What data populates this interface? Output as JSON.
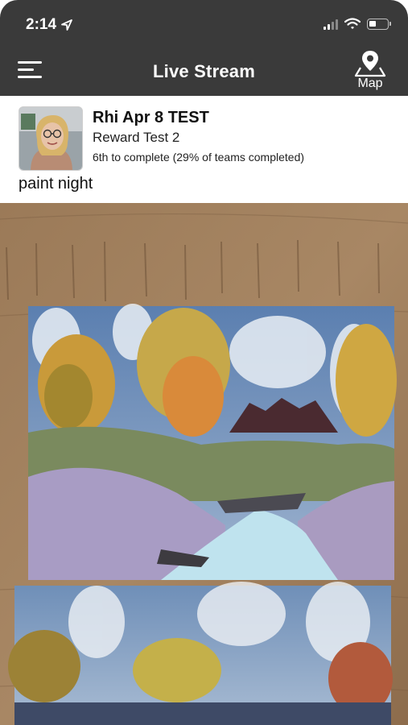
{
  "status_bar": {
    "time": "2:14",
    "location_icon": "location-arrow-icon",
    "signal_icon": "cellular-signal-icon",
    "wifi_icon": "wifi-icon",
    "battery_icon": "battery-icon",
    "battery_level": 0.35
  },
  "nav": {
    "menu_icon": "hamburger-menu-icon",
    "title": "Live Stream",
    "map_icon": "map-pin-icon",
    "map_label": "Map"
  },
  "post": {
    "name": "Rhi Apr 8 TEST",
    "reward": "Reward Test 2",
    "status": "6th to complete (29% of teams completed)",
    "caption": "paint night"
  },
  "photo": {
    "subject": "photo-of-two-landscape-paintings"
  },
  "colors": {
    "header_bg": "#3a3a3a",
    "header_text": "#ffffff",
    "body_bg": "#ffffff"
  }
}
